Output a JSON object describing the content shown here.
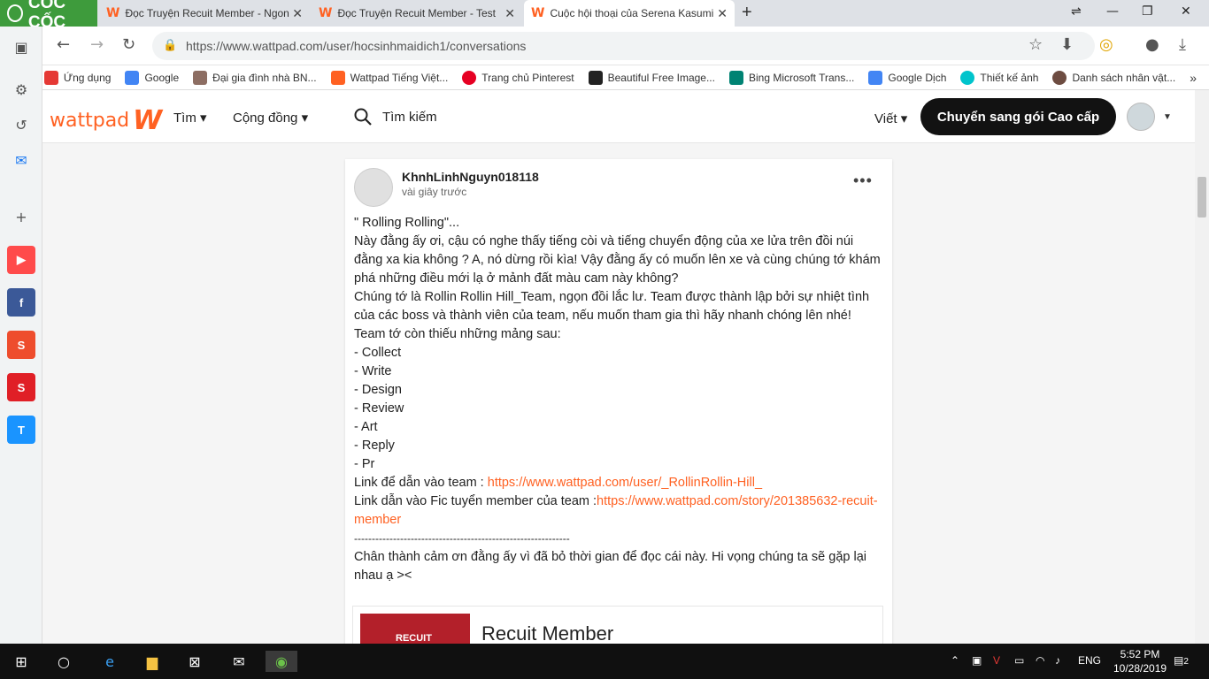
{
  "browser": {
    "brand": "CỐC CỐC",
    "tabs": [
      {
        "title": "Đọc Truyện Recuit Member - Ngon",
        "active": false
      },
      {
        "title": "Đọc Truyện Recuit Member - Test",
        "active": false
      },
      {
        "title": "Cuộc hội thoại của Serena Kasumi",
        "active": true
      }
    ],
    "url": "https://www.wattpad.com/user/hocsinhmaidich1/conversations",
    "bookmarks": [
      {
        "label": "Ứng dụng",
        "color": "#e53935"
      },
      {
        "label": "Google",
        "color": "#4285f4"
      },
      {
        "label": "Đại gia đình nhà BN...",
        "color": "#8d6e63"
      },
      {
        "label": "Wattpad Tiếng Việt...",
        "color": "#ff6122"
      },
      {
        "label": "Trang chủ Pinterest",
        "color": "#e60023"
      },
      {
        "label": "Beautiful Free Image...",
        "color": "#222222"
      },
      {
        "label": "Bing Microsoft Trans...",
        "color": "#008373"
      },
      {
        "label": "Google Dịch",
        "color": "#4285f4"
      },
      {
        "label": "Thiết kế ảnh",
        "color": "#00c4cc"
      },
      {
        "label": "Danh sách nhân vật...",
        "color": "#6d4c41"
      }
    ]
  },
  "wattpad": {
    "logo": "wattpad",
    "nav_find": "Tìm ▾",
    "nav_community": "Cộng đồng ▾",
    "search": "Tìm kiếm",
    "write": "Viết ▾",
    "premium": "Chuyển sang gói Cao cấp"
  },
  "message": {
    "username": "KhnhLinhNguyn018118",
    "time": "vài giây trước",
    "lines": [
      "\" Rolling Rolling\"...",
      "Này đằng ấy ơi, cậu có nghe thấy tiếng còi và tiếng chuyển động của xe lửa trên đồi núi đằng xa kia không ? A, nó dừng rồi kìa! Vậy đằng ấy có muốn lên xe và cùng chúng tớ khám phá những điều mới lạ ở mảnh đất màu cam này không?",
      "Chúng tớ là Rollin Rollin Hill_Team, ngọn đồi lắc lư. Team được thành lập bởi sự nhiệt tình của các boss và thành viên của team, nếu muốn tham gia thì hãy nhanh chóng lên nhé!",
      "Team tớ còn thiếu những mảng sau:",
      "- Collect",
      "- Write",
      "- Design",
      "- Review",
      "- Art",
      "- Reply",
      "- Pr"
    ],
    "link1_label": "Link để dẫn vào team : ",
    "link1_url": "https://www.wattpad.com/user/_RollinRollin-Hill_",
    "link2_label": "Link dẫn vào Fic tuyển member của team :",
    "link2_url": "https://www.wattpad.com/story/201385632-recuit-member",
    "divider": "-------------------------------------------------------------",
    "closing": "Chân thành cảm ơn đằng ấy vì đã bỏ thời gian để đọc cái này. Hi vọng chúng ta sẽ gặp lại nhau ạ ><"
  },
  "story_card": {
    "cover_text": "RECUIT",
    "title": "Recuit Member"
  },
  "taskbar": {
    "lang": "ENG",
    "time": "5:52 PM",
    "date": "10/28/2019",
    "notifications": "2"
  }
}
